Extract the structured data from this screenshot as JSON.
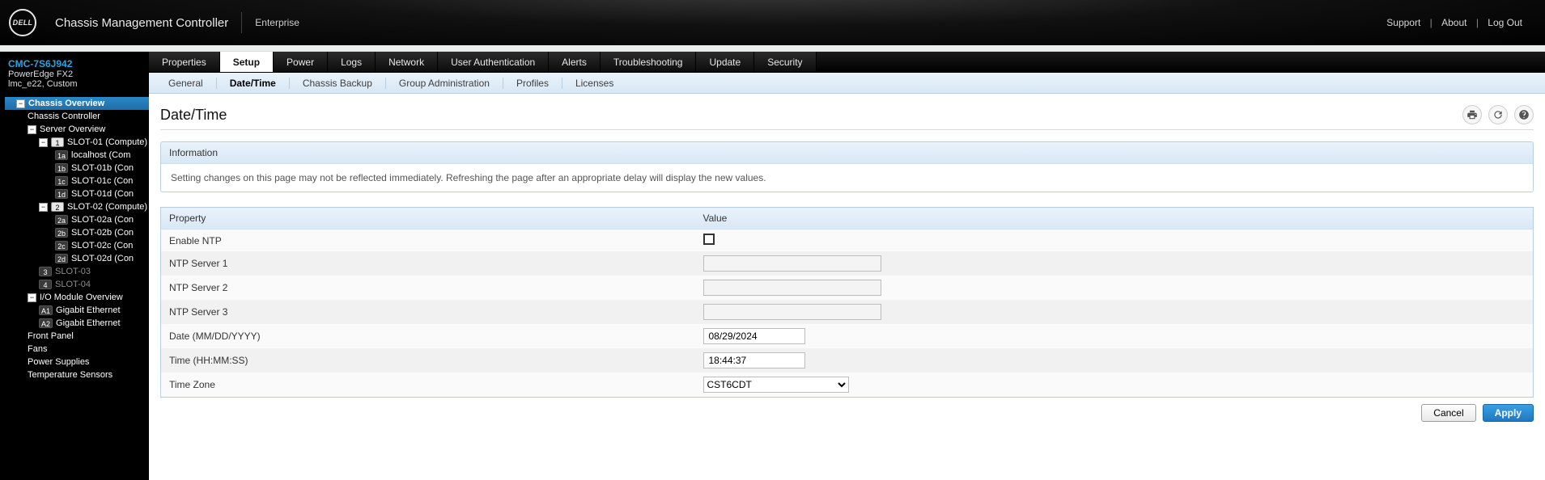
{
  "brand": {
    "logo_text": "DELL",
    "app_title": "Chassis Management Controller",
    "context": "Enterprise"
  },
  "top_links": {
    "support": "Support",
    "about": "About",
    "logout": "Log Out"
  },
  "system": {
    "service_tag": "CMC-7S6J942",
    "model": "PowerEdge FX2",
    "subname": "lmc_e22, Custom"
  },
  "nav_tree": {
    "chassis_overview": "Chassis Overview",
    "chassis_controller": "Chassis Controller",
    "server_overview": "Server Overview",
    "slot01": {
      "badge": "1",
      "label": "SLOT-01 (Compute)",
      "subs": [
        {
          "badge": "1a",
          "label": "localhost (Com"
        },
        {
          "badge": "1b",
          "label": "SLOT-01b (Con"
        },
        {
          "badge": "1c",
          "label": "SLOT-01c (Con"
        },
        {
          "badge": "1d",
          "label": "SLOT-01d (Con"
        }
      ]
    },
    "slot02": {
      "badge": "2",
      "label": "SLOT-02 (Compute)",
      "subs": [
        {
          "badge": "2a",
          "label": "SLOT-02a (Con"
        },
        {
          "badge": "2b",
          "label": "SLOT-02b (Con"
        },
        {
          "badge": "2c",
          "label": "SLOT-02c (Con"
        },
        {
          "badge": "2d",
          "label": "SLOT-02d (Con"
        }
      ]
    },
    "slot03": {
      "badge": "3",
      "label": "SLOT-03"
    },
    "slot04": {
      "badge": "4",
      "label": "SLOT-04"
    },
    "io_overview": "I/O Module Overview",
    "io_a1": {
      "badge": "A1",
      "label": "Gigabit Ethernet"
    },
    "io_a2": {
      "badge": "A2",
      "label": "Gigabit Ethernet"
    },
    "front_panel": "Front Panel",
    "fans": "Fans",
    "power_supplies": "Power Supplies",
    "temp_sensors": "Temperature Sensors"
  },
  "tabs_primary": [
    "Properties",
    "Setup",
    "Power",
    "Logs",
    "Network",
    "User Authentication",
    "Alerts",
    "Troubleshooting",
    "Update",
    "Security"
  ],
  "tabs_primary_active": 1,
  "tabs_secondary": [
    "General",
    "Date/Time",
    "Chassis Backup",
    "Group Administration",
    "Profiles",
    "Licenses"
  ],
  "tabs_secondary_active": 1,
  "page": {
    "title": "Date/Time",
    "info_header": "Information",
    "info_body": "Setting changes on this page may not be reflected immediately. Refreshing the page after an appropriate delay will display the new values.",
    "columns": {
      "property": "Property",
      "value": "Value"
    },
    "rows": {
      "enable_ntp": "Enable NTP",
      "ntp1": "NTP Server 1",
      "ntp2": "NTP Server 2",
      "ntp3": "NTP Server 3",
      "date": "Date (MM/DD/YYYY)",
      "time": "Time (HH:MM:SS)",
      "tz": "Time Zone"
    },
    "values": {
      "enable_ntp_checked": false,
      "ntp1": "",
      "ntp2": "",
      "ntp3": "",
      "date": "08/29/2024",
      "time": "18:44:37",
      "tz": "CST6CDT"
    },
    "buttons": {
      "cancel": "Cancel",
      "apply": "Apply"
    }
  }
}
